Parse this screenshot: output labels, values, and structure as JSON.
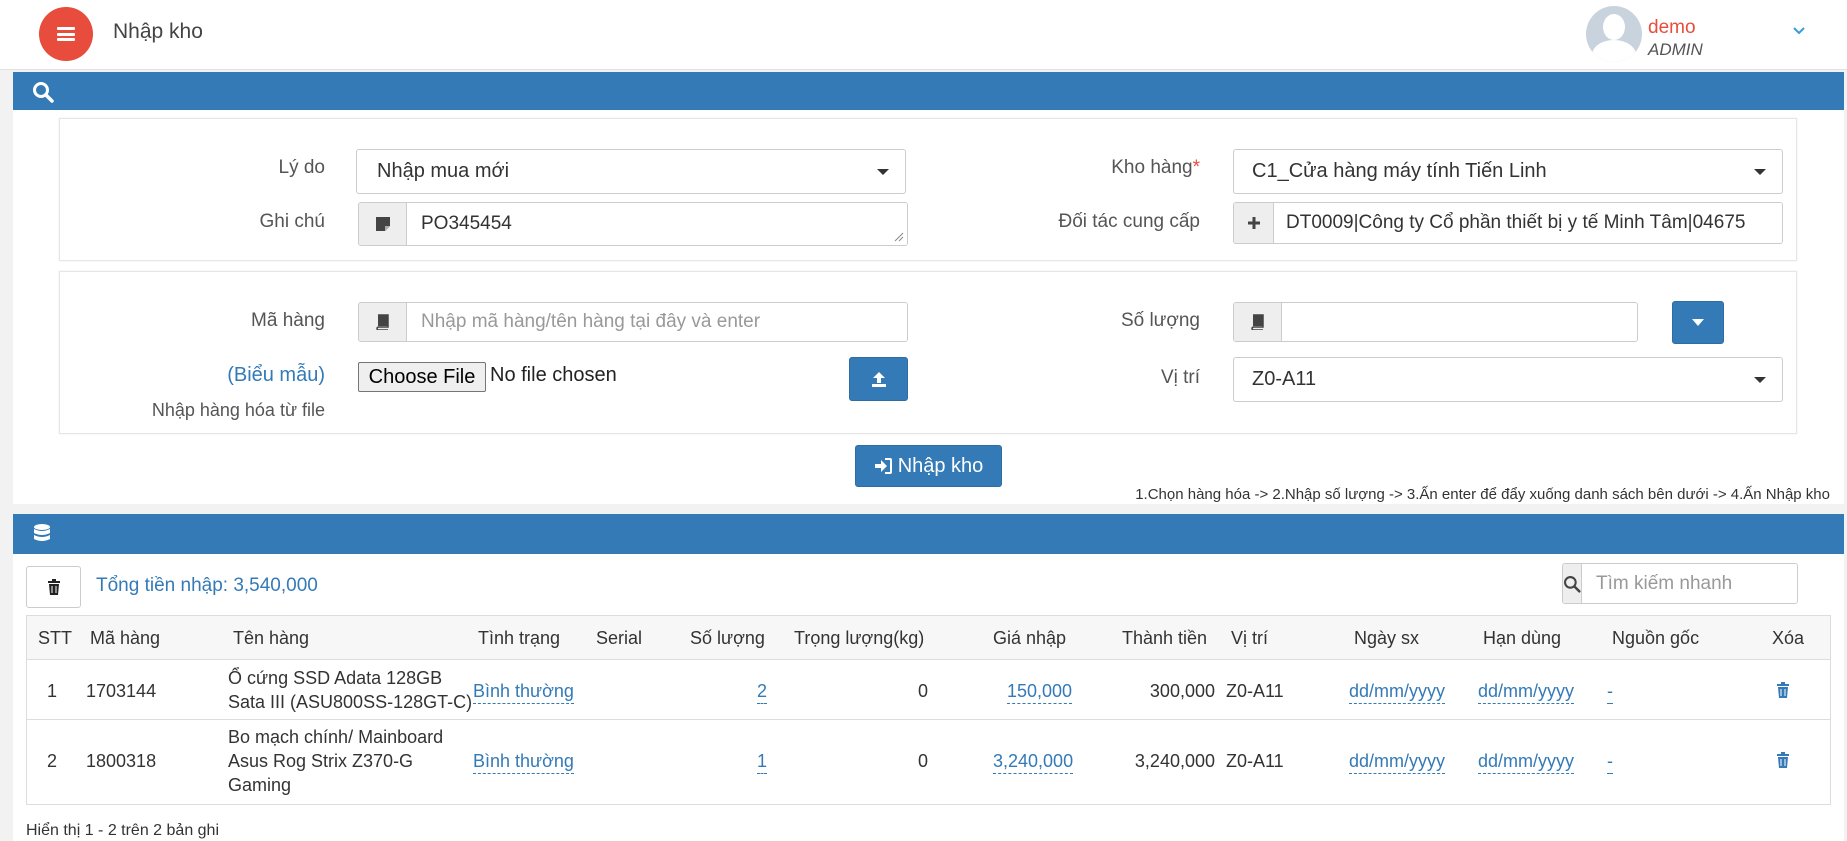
{
  "header": {
    "title": "Nhập kho",
    "user_name": "demo",
    "user_role": "ADMIN"
  },
  "form": {
    "reason_label": "Lý do",
    "reason_value": "Nhập mua mới",
    "note_label": "Ghi chú",
    "note_value": "PO345454",
    "warehouse_label": "Kho hàng",
    "warehouse_required": "*",
    "warehouse_value": "C1_Cửa hàng máy tính Tiến Linh",
    "supplier_label": "Đối tác cung cấp",
    "supplier_value": "DT0009|Công ty Cổ phần thiết bị y tế Minh Tâm|04675",
    "product_code_label": "Mã hàng",
    "product_code_placeholder": "Nhập mã hàng/tên hàng tại đây và enter",
    "quantity_label": "Số lượng",
    "quantity_value": "",
    "template_link": "(Biểu mẫu)",
    "import_file_label": "Nhập hàng hóa từ file",
    "choose_file_label": "Choose File",
    "no_file_label": "No file chosen",
    "location_label": "Vị trí",
    "location_value": "Z0-A11",
    "submit_label": "Nhập kho",
    "instructions": "1.Chọn hàng hóa -> 2.Nhập số lượng -> 3.Ấn enter để đẩy xuống danh sách bên dưới -> 4.Ấn Nhập kho"
  },
  "list": {
    "total_label": "Tổng tiền nhập: 3,540,000",
    "search_placeholder": "Tìm kiếm nhanh",
    "columns": [
      "STT",
      "Mã hàng",
      "Tên hàng",
      "Tình trạng",
      "Serial",
      "Số lượng",
      "Trọng lượng(kg)",
      "Giá nhập",
      "Thành tiền",
      "Vị trí",
      "Ngày sx",
      "Hạn dùng",
      "Nguồn gốc",
      "Xóa"
    ],
    "rows": [
      {
        "stt": "1",
        "code": "1703144",
        "name_lines": [
          "Ổ cứng SSD Adata 128GB",
          "Sata III (ASU800SS-128GT-C)"
        ],
        "status": "Bình thường",
        "serial": "",
        "qty": "2",
        "weight": "0",
        "price": "150,000",
        "total": "300,000",
        "location": "Z0-A11",
        "mfg_date": "dd/mm/yyyy",
        "exp_date": "dd/mm/yyyy",
        "origin": "-"
      },
      {
        "stt": "2",
        "code": "1800318",
        "name_lines": [
          "Bo mạch chính/ Mainboard",
          "Asus Rog Strix Z370-G",
          "Gaming"
        ],
        "status": "Bình thường",
        "serial": "",
        "qty": "1",
        "weight": "0",
        "price": "3,240,000",
        "total": "3,240,000",
        "location": "Z0-A11",
        "mfg_date": "dd/mm/yyyy",
        "exp_date": "dd/mm/yyyy",
        "origin": "-"
      }
    ],
    "footer": "Hiển thị 1 - 2 trên 2 bản ghi"
  }
}
